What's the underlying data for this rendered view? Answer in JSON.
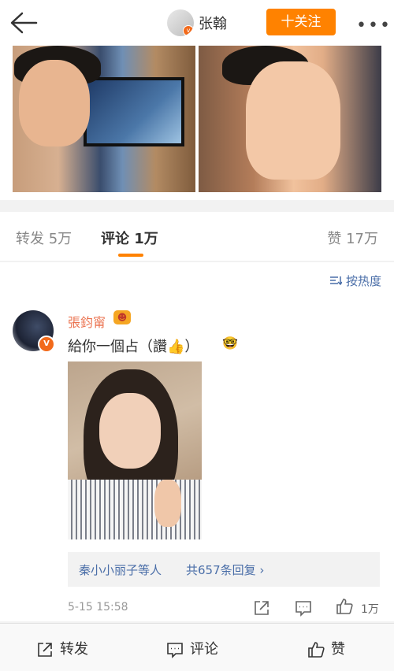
{
  "header": {
    "user_name": "张翰",
    "follow_label": "十关注",
    "more_label": "•••"
  },
  "tabs": {
    "forward": "转发 5万",
    "comments": "评论 1万",
    "likes": "赞 17万"
  },
  "sort_label": "按热度",
  "comment": {
    "author": "張鈞甯",
    "text": "給你一個占（讚",
    "text_end": "）",
    "thumbs_emoji": "👍",
    "nerd_emoji": "🤓",
    "reply_people": "秦小小丽子等人",
    "reply_count": "共657条回复",
    "reply_arrow": "›",
    "time": "5-15 15:58",
    "like_count": "1万"
  },
  "bottom_bar": {
    "forward": "转发",
    "comment": "评论",
    "like": "赞"
  },
  "colors": {
    "accent": "#ff8200",
    "link": "#4a6ea8",
    "name": "#eb7350"
  }
}
